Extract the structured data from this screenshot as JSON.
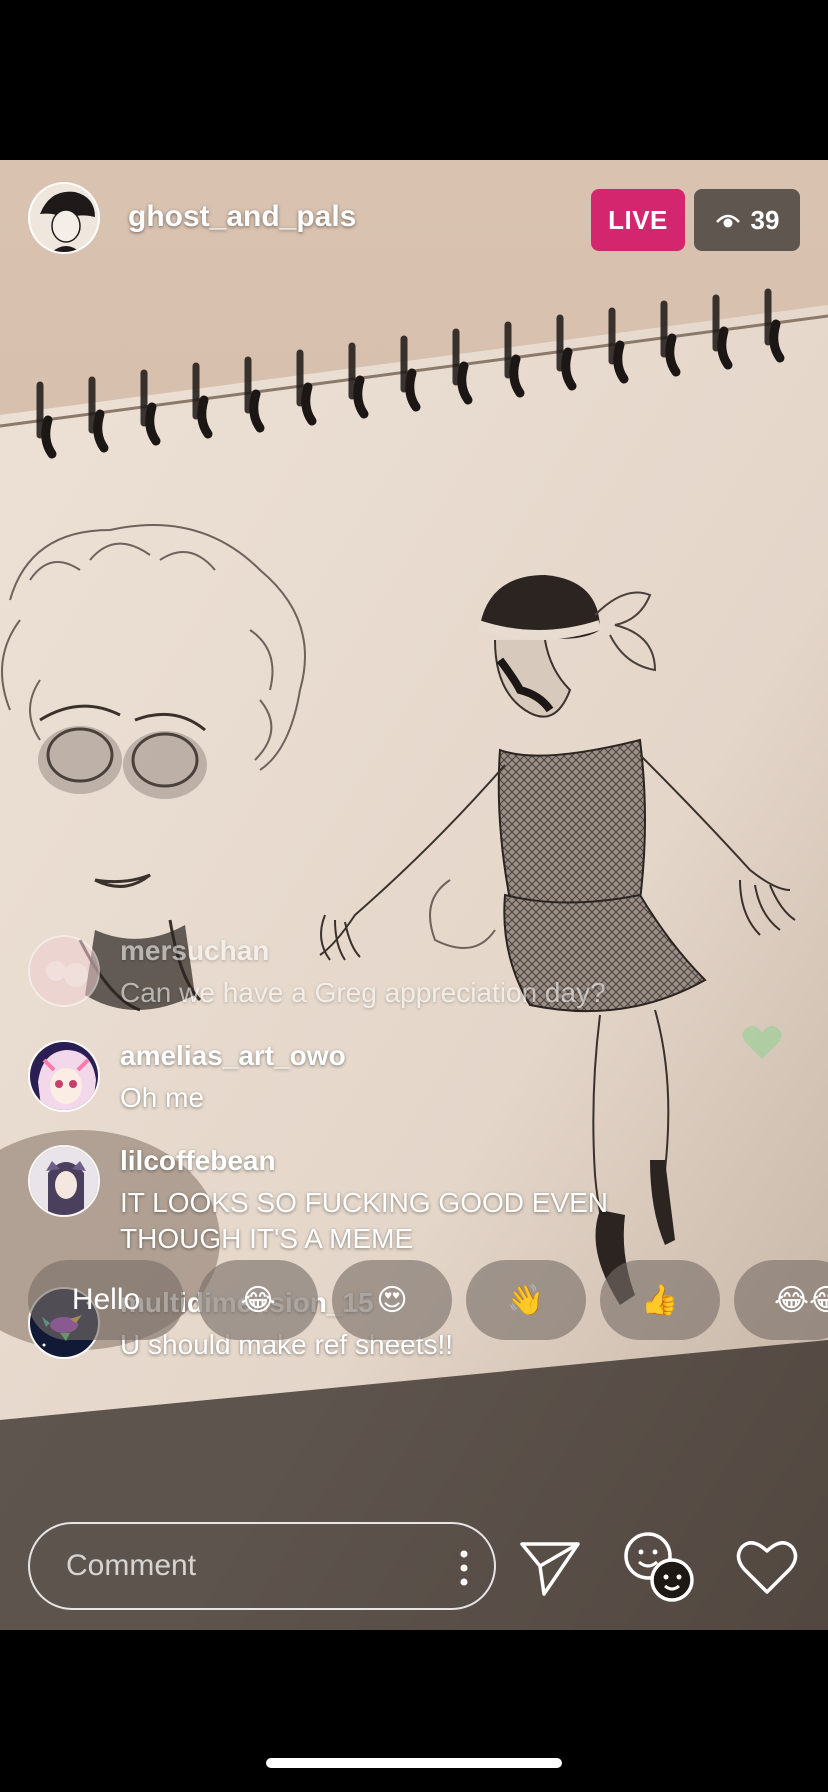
{
  "header": {
    "host_name": "ghost_and_pals",
    "live_label": "LIVE",
    "viewer_count": "39",
    "viewer_icon": "eye-icon"
  },
  "comments": [
    {
      "user": "mersuchan",
      "text": "Can we have a Greg appreciation day?"
    },
    {
      "user": "amelias_art_owo",
      "text": "Oh me"
    },
    {
      "user": "lilcoffebean",
      "text": "IT LOOKS SO FUCKING GOOD EVEN THOUGH IT'S A MEME"
    },
    {
      "user": "multidimension_15",
      "text": "U should make ref sheets!!"
    }
  ],
  "reactions": {
    "hello_label": "Hello",
    "emojis": [
      "😂",
      "😍",
      "👋",
      "👍",
      "😂😂"
    ]
  },
  "composer": {
    "placeholder": "Comment",
    "icons": [
      "more-icon",
      "send-icon",
      "face-filter-icon",
      "heart-icon"
    ]
  },
  "colors": {
    "live_badge": "#d4266e",
    "background": "#000000"
  }
}
